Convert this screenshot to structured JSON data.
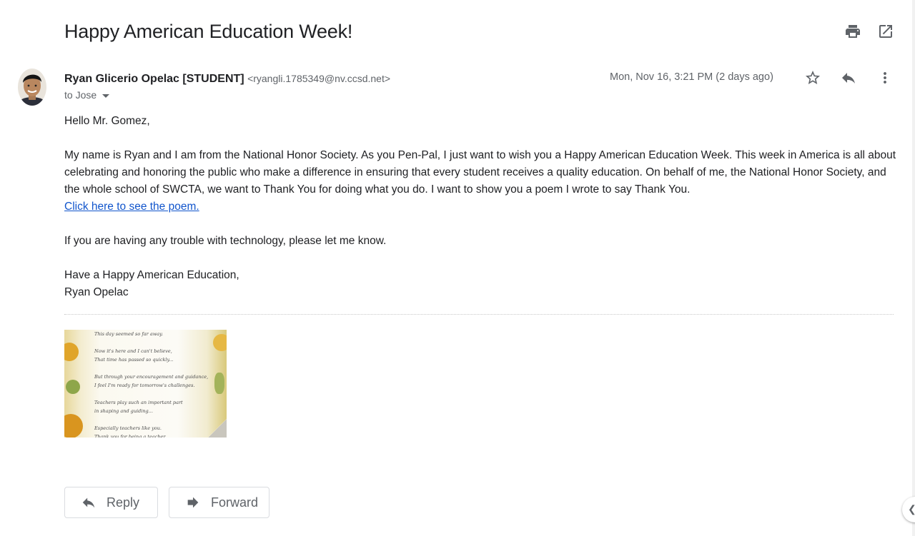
{
  "email": {
    "subject": "Happy American Education Week!",
    "sender_name": "Ryan Glicerio Opelac [STUDENT]",
    "sender_email": "<ryangli.1785349@nv.ccsd.net>",
    "to_line": "to Jose",
    "date": "Mon, Nov 16, 3:21 PM (2 days ago)",
    "greeting": "Hello Mr. Gomez,",
    "paragraph1": "My name is Ryan and I am from the National Honor Society. As you Pen-Pal, I just want to wish you a Happy American Education Week. This week in America is all about celebrating and honoring the public who make a difference in ensuring that every student receives a quality education. On behalf of me, the National Honor Society, and the whole school of SWCTA, we want to Thank You for doing what you do. I want to show you a poem I wrote to say Thank You.",
    "link_text": "Click here to see the poem.",
    "paragraph2": "If you are having any trouble with technology, please let me know.",
    "closing": "Have a Happy American Education,",
    "signature": "Ryan Opelac"
  },
  "attachment": {
    "poem_lines": [
      "This day seemed so far away.",
      "",
      "Now it's here and I can't believe,",
      "That time has passed so quickly...",
      "",
      "But through your encouragement and guidance,",
      "I feel I'm ready for tomorrow's challenges.",
      "",
      "Teachers play such an important part",
      "in shaping and guiding...",
      "",
      "Especially teachers like you.",
      "Thank you for being a teacher."
    ]
  },
  "actions": {
    "reply_label": "Reply",
    "forward_label": "Forward"
  },
  "icons": {
    "print": "print-icon",
    "open_new_window": "open-in-new-icon",
    "star": "star-icon",
    "reply": "reply-icon",
    "more": "more-vert-icon",
    "forward": "forward-icon"
  },
  "colors": {
    "link": "#1155cc",
    "icon": "#5f6368",
    "text": "#202124"
  }
}
